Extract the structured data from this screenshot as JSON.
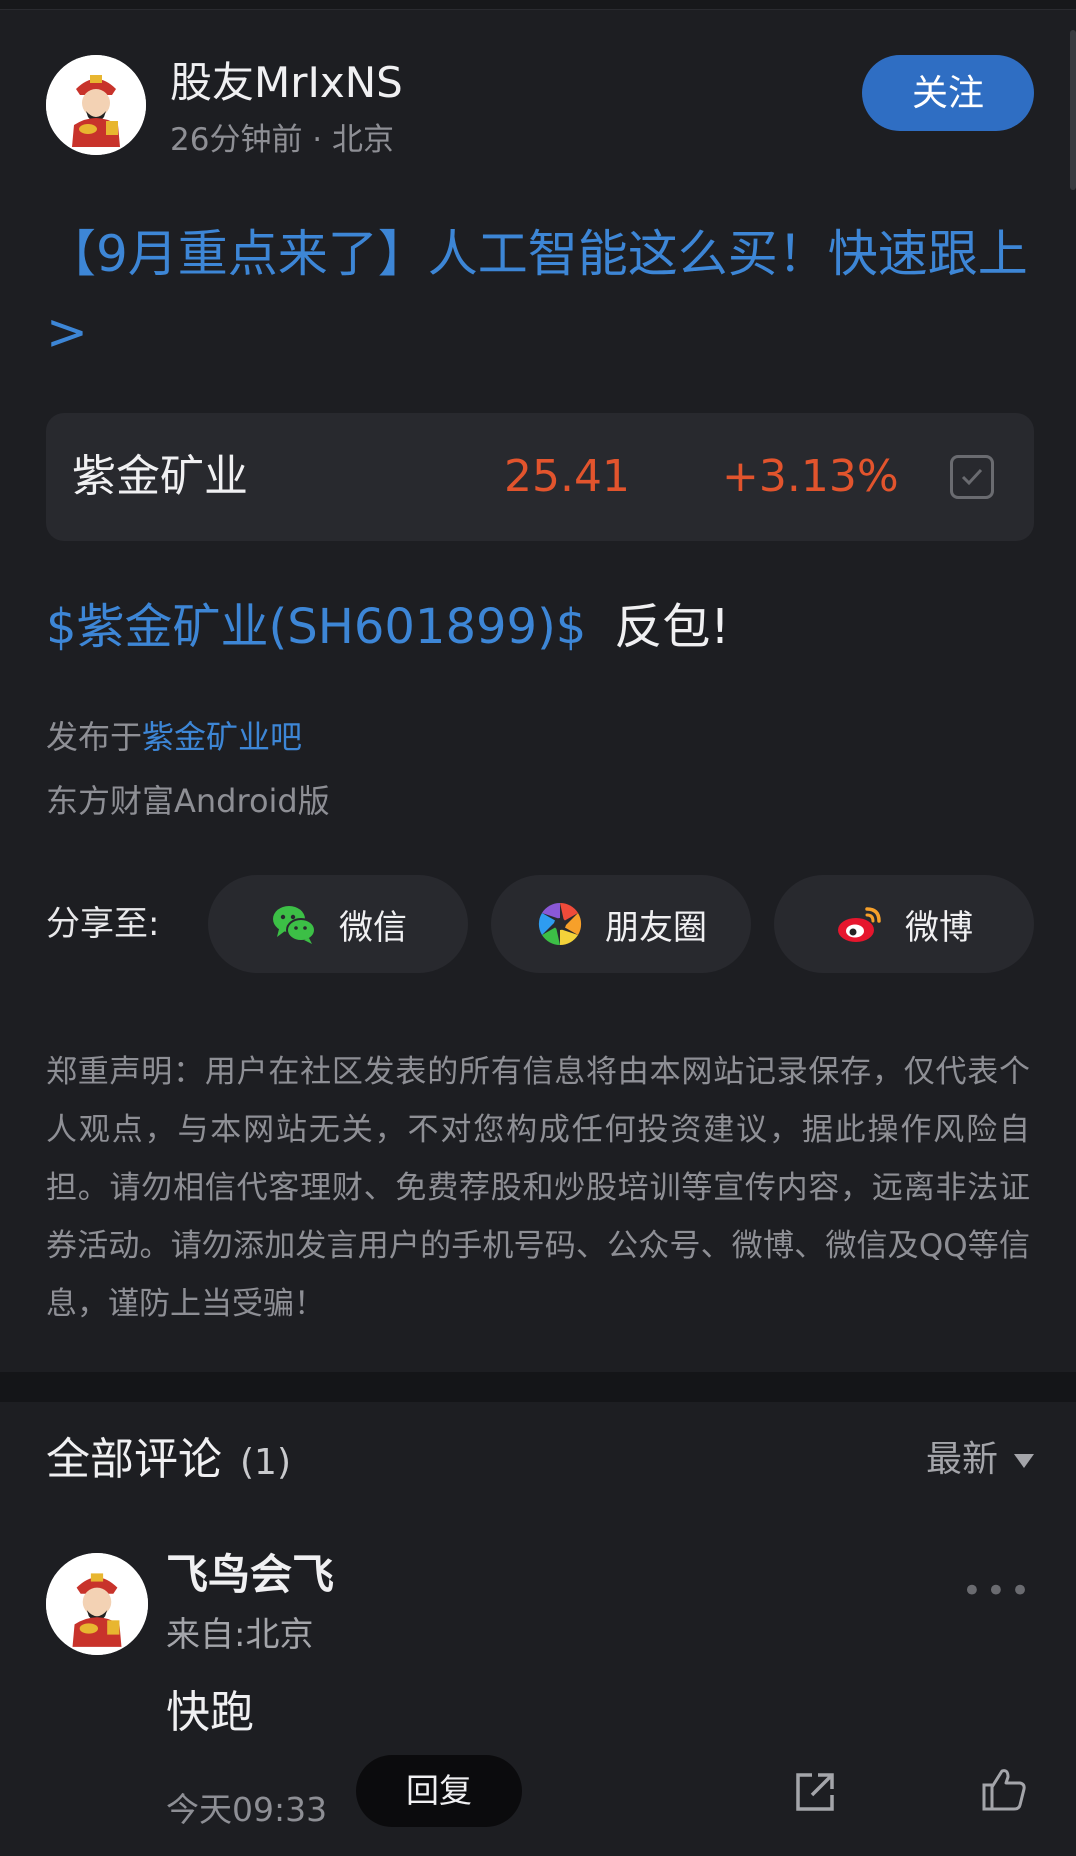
{
  "post": {
    "author": "股友MrIxNS",
    "meta": "26分钟前 · 北京",
    "follow_label": "关注",
    "promo_title": "【9月重点来了】人工智能这么买！快速跟上>",
    "stock_card": {
      "name": "紫金矿业",
      "price": "25.41",
      "change": "+3.13%"
    },
    "content_tag": "$紫金矿业(SH601899)$",
    "content_text": "反包!",
    "published_prefix": "发布于",
    "published_forum": "紫金矿业吧",
    "client": "东方财富Android版"
  },
  "share": {
    "label": "分享至:",
    "targets": [
      {
        "label": "微信",
        "icon": "wechat-icon"
      },
      {
        "label": "朋友圈",
        "icon": "moments-icon"
      },
      {
        "label": "微博",
        "icon": "weibo-icon"
      }
    ]
  },
  "disclaimer": "郑重声明：用户在社区发表的所有信息将由本网站记录保存，仅代表个人观点，与本网站无关，不对您构成任何投资建议，据此操作风险自担。请勿相信代客理财、免费荐股和炒股培训等宣传内容，远离非法证券活动。请勿添加发言用户的手机号码、公众号、微博、微信及QQ等信息，谨防上当受骗！",
  "comments": {
    "title": "全部评论",
    "count": "(1)",
    "sort_label": "最新",
    "items": [
      {
        "user": "飞鸟会飞",
        "location": "来自:北京",
        "text": "快跑",
        "time": "今天09:33",
        "reply_label": "回复"
      }
    ]
  },
  "colors": {
    "accent": "#2f6ec3",
    "link": "#3d86d6",
    "up": "#e2542d",
    "background": "#1d1e22"
  }
}
